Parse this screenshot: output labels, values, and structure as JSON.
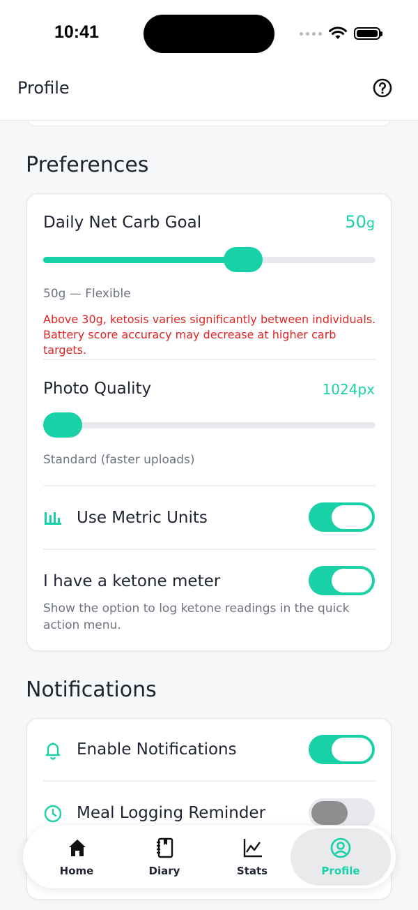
{
  "status_bar": {
    "time": "10:41"
  },
  "header": {
    "title": "Profile"
  },
  "preferences": {
    "section_title": "Preferences",
    "carb_goal": {
      "label": "Daily Net Carb Goal",
      "value": "50",
      "unit": "g",
      "slider_fraction": 0.6,
      "caption": "50g — Flexible",
      "warning_line1": "Above 30g, ketosis varies significantly between individuals.",
      "warning_line2": "Battery score accuracy may decrease at higher carb targets."
    },
    "photo_quality": {
      "label": "Photo Quality",
      "value": "1024px",
      "slider_fraction": 0.0,
      "caption": "Standard (faster uploads)"
    },
    "metric_units": {
      "label": "Use Metric Units",
      "enabled": true,
      "icon": "bar-chart-icon"
    },
    "ketone_meter": {
      "label": "I have a ketone meter",
      "enabled": true,
      "description": "Show the option to log ketone readings in the quick action menu."
    }
  },
  "notifications": {
    "section_title": "Notifications",
    "enable": {
      "label": "Enable Notifications",
      "enabled": true,
      "icon": "bell-icon"
    },
    "meal_reminder": {
      "label": "Meal Logging Reminder",
      "enabled": false,
      "icon": "clock-icon"
    }
  },
  "bottom_nav": {
    "items": [
      {
        "label": "Home",
        "icon": "home-icon"
      },
      {
        "label": "Diary",
        "icon": "diary-icon"
      },
      {
        "label": "Stats",
        "icon": "stats-icon"
      },
      {
        "label": "Profile",
        "icon": "profile-icon",
        "active": true
      }
    ]
  },
  "colors": {
    "accent": "#18d1a6",
    "warning": "#e02424",
    "muted": "#6d7380"
  }
}
